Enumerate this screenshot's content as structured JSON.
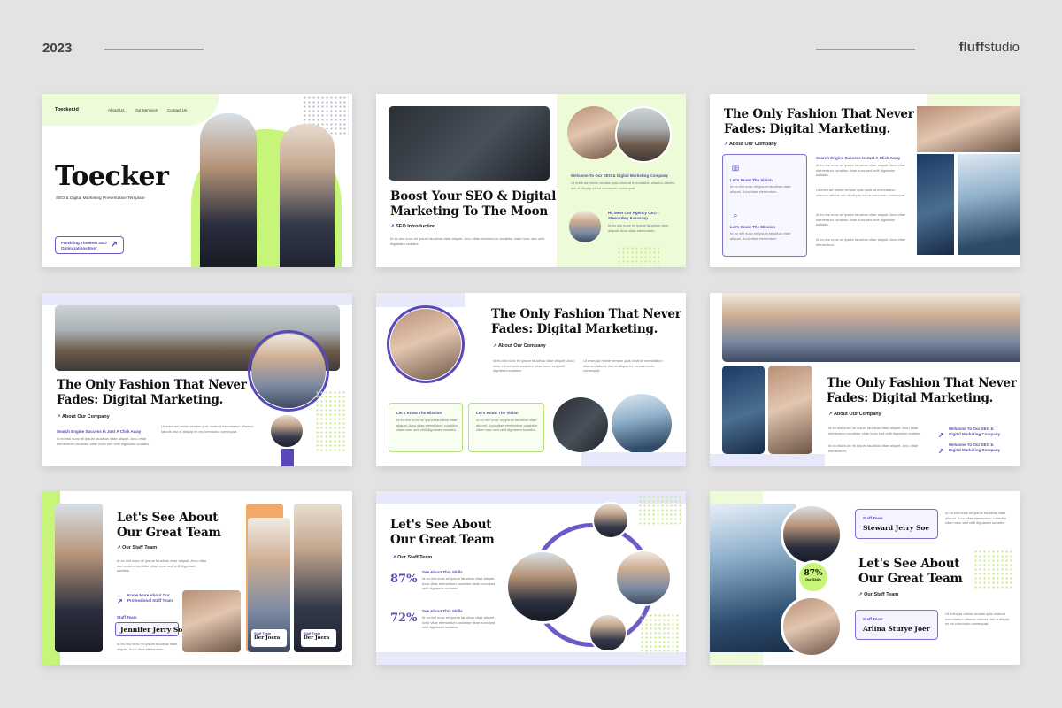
{
  "header": {
    "year": "2023",
    "brand_bold": "fluff",
    "brand_rest": "studio"
  },
  "colors": {
    "accent": "#5848b8",
    "lime": "#c6f57a",
    "lavender": "#e7e9fb"
  },
  "lorem": {
    "p1": "Id eu nisl nunc mi ipsum faucibus vitae aliquet. Arcu vitae elementum curabitur vitae nunc sed velit dignissim sodales.",
    "p2": "Ut enim ad minim veniam quis nostrud exercitation ullamco laboris nisi ut aliquip ex ea commodo consequat.",
    "p3": "Id eu nisl nunc mi ipsum faucibus vitae aliquet. Arcu vitae elementum."
  },
  "s1": {
    "logo": "Toecker.id",
    "nav": [
      "About Us",
      "Our Services",
      "Contact Us"
    ],
    "title": "Toecker",
    "subtitle": "SEO & Digital Marketing Presentation Template",
    "button_line1": "Providing The Best SEO",
    "button_line2": "Optimizations Ever",
    "button_icon": "arrow-up-right-icon"
  },
  "s2": {
    "title_l1": "Boost Your SEO & Digital",
    "title_l2": "Marketing To The Moon",
    "tag": "SEO Introduction",
    "welcome": "Welcome To Our SEO & Digital Marketing Company",
    "ceo_l1": "Hi, Meet Our Agency CEO -",
    "ceo_l2": "Stewardwy Karasaap"
  },
  "s3": {
    "title_l1": "The Only Fashion That Never",
    "title_l2": "Fades: Digital Marketing.",
    "tag": "About Our Company",
    "vision": "Let's Know The Vision",
    "mission": "Let's Know The Mission",
    "search": "Search Engine Success Is Just A Click Away"
  },
  "s4": {
    "title_l1": "The Only Fashion That Never",
    "title_l2": "Fades: Digital Marketing.",
    "tag": "About Our Company",
    "search": "Search Engine Success Is Just A Click Away"
  },
  "s5": {
    "title_l1": "The Only Fashion That Never",
    "title_l2": "Fades: Digital Marketing.",
    "tag": "About Our Company",
    "mission": "Let's Know The Mission",
    "vision": "Let's Know The Vision"
  },
  "s6": {
    "title_l1": "The Only Fashion That Never",
    "title_l2": "Fades: Digital Marketing.",
    "tag": "About Our Company",
    "link1_l1": "Welcome To Our SEO &",
    "link1_l2": "Digital Marketing Company",
    "link2_l1": "Welcome To Our SEO &",
    "link2_l2": "Digital Marketing Company"
  },
  "s7": {
    "title_l1": "Let's See About",
    "title_l2": "Our Great Team",
    "tag": "Our Staff Team",
    "link_l1": "Know More About Our",
    "link_l2": "Professional Staff Team",
    "staff_label": "Staff Team",
    "staff_name": "Jennifer Jerry Soe",
    "card_label": "Staff Team",
    "card_name": "Der Joera"
  },
  "s8": {
    "title_l1": "Let's See About",
    "title_l2": "Our Great Team",
    "tag": "Our Staff Team",
    "stat1": "87%",
    "stat2": "72%",
    "skill1": "See About This Skills",
    "skill2": "See About This Skills"
  },
  "s9": {
    "title_l1": "Let's See About",
    "title_l2": "Our Great Team",
    "tag": "Our Staff Team",
    "staff1_label": "Staff Team",
    "staff1_name": "Steward Jerry Soe",
    "staff2_label": "Staff Team",
    "staff2_name": "Arlina Sturye Joer",
    "stat": "87%",
    "stat_label": "Our Skills"
  }
}
